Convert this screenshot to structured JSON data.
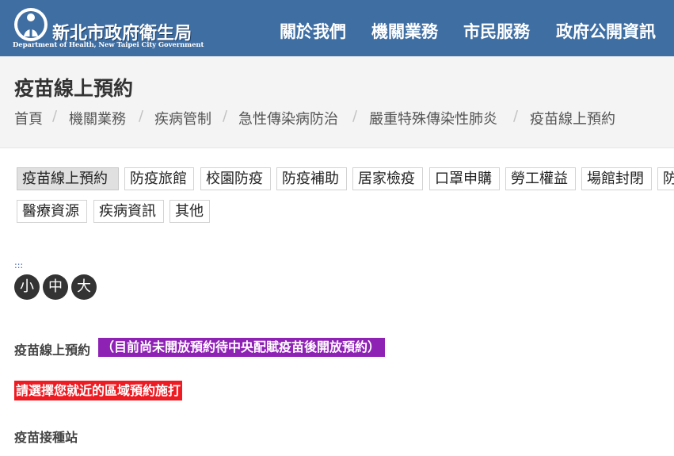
{
  "header": {
    "logo_cn": "新北市政府衛生局",
    "logo_en": "Department of Health, New Taipei City Government",
    "nav": [
      "關於我們",
      "機關業務",
      "市民服務",
      "政府公開資訊"
    ]
  },
  "page": {
    "title": "疫苗線上預約",
    "breadcrumb": [
      "首頁",
      "機關業務",
      "疾病管制",
      "急性傳染病防治",
      "嚴重特殊傳染性肺炎",
      "疫苗線上預約"
    ],
    "separator": "/"
  },
  "tags": [
    "疫苗線上預約",
    "防疫旅館",
    "校園防疫",
    "防疫補助",
    "居家檢疫",
    "口罩申購",
    "勞工權益",
    "場館封閉",
    "防",
    "醫療資源",
    "疾病資訊",
    "其他"
  ],
  "active_tag": "疫苗線上預約",
  "accessibility": {
    "skip_link": ":::",
    "font_small": "小",
    "font_medium": "中",
    "font_large": "大"
  },
  "content": {
    "line1_label": "疫苗線上預約",
    "line1_highlight": "（目前尚未開放預約待中央配賦疫苗後開放預約）",
    "line2": "請選擇您就近的區域預約施打",
    "line3": "疫苗接種站"
  },
  "colors": {
    "header_bg": "#3f6ea3",
    "highlight_purple": "#8e22b5",
    "highlight_red": "#ee1b22"
  }
}
